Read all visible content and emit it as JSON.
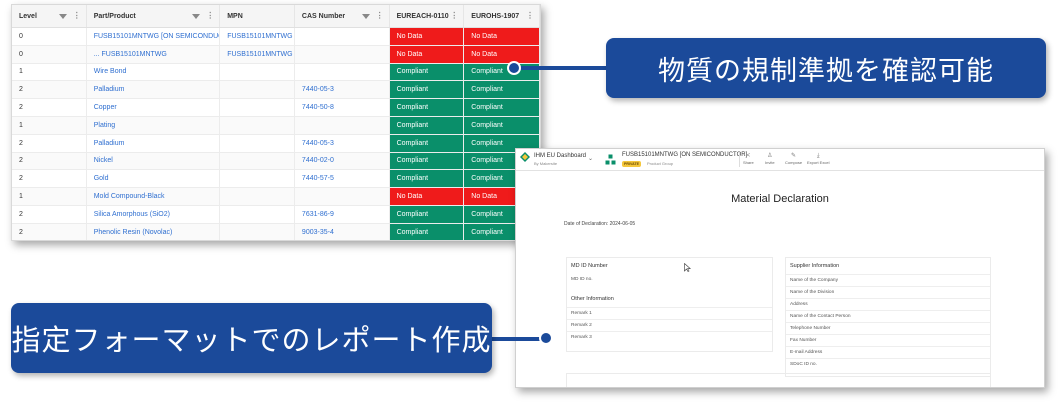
{
  "table": {
    "headers": [
      "Level",
      "Part/Product",
      "MPN",
      "CAS Number",
      "EUREACH-0110",
      "EUROHS-1907"
    ],
    "rows": [
      {
        "level": "0",
        "part": "FUSB15101MNTWG [ON SEMICONDUCTOR]",
        "mpn": "FUSB15101MNTWG",
        "cas": "",
        "reach": "No Data",
        "rohs": "No Data"
      },
      {
        "level": "0",
        "part": "... FUSB15101MNTWG",
        "mpn": "FUSB15101MNTWG",
        "cas": "",
        "reach": "No Data",
        "rohs": "No Data"
      },
      {
        "level": "1",
        "part": "Wire Bond",
        "mpn": "",
        "cas": "",
        "reach": "Compliant",
        "rohs": "Compliant"
      },
      {
        "level": "2",
        "part": "Palladium",
        "mpn": "",
        "cas": "7440-05-3",
        "reach": "Compliant",
        "rohs": "Compliant"
      },
      {
        "level": "2",
        "part": "Copper",
        "mpn": "",
        "cas": "7440-50-8",
        "reach": "Compliant",
        "rohs": "Compliant"
      },
      {
        "level": "1",
        "part": "Plating",
        "mpn": "",
        "cas": "",
        "reach": "Compliant",
        "rohs": "Compliant"
      },
      {
        "level": "2",
        "part": "Palladium",
        "mpn": "",
        "cas": "7440-05-3",
        "reach": "Compliant",
        "rohs": "Compliant"
      },
      {
        "level": "2",
        "part": "Nickel",
        "mpn": "",
        "cas": "7440-02-0",
        "reach": "Compliant",
        "rohs": "Compliant"
      },
      {
        "level": "2",
        "part": "Gold",
        "mpn": "",
        "cas": "7440-57-5",
        "reach": "Compliant",
        "rohs": "Compliant"
      },
      {
        "level": "1",
        "part": "Mold Compound-Black",
        "mpn": "",
        "cas": "",
        "reach": "No Data",
        "rohs": "No Data"
      },
      {
        "level": "2",
        "part": "Silica Amorphous (SiO2)",
        "mpn": "",
        "cas": "7631-86-9",
        "reach": "Compliant",
        "rohs": "Compliant"
      },
      {
        "level": "2",
        "part": "Phenolic Resin (Novolac)",
        "mpn": "",
        "cas": "9003-35-4",
        "reach": "Compliant",
        "rohs": "Compliant"
      }
    ]
  },
  "callouts": {
    "top": "物質の規制準拠を確認可能",
    "bottom": "指定フォーマットでのレポート作成"
  },
  "app": {
    "dashboard_title": "IHM EU Dashboard",
    "dashboard_sub": "By Makersite",
    "product_title": "FUSB15101MNTWG [ON SEMICONDUCTOR]",
    "badge": "PRIVATE",
    "product_group": "Product Group",
    "toolbar": {
      "share": "Share",
      "invite": "Invite",
      "compose": "Compose",
      "export": "Export Excel"
    }
  },
  "doc": {
    "title": "Material Declaration",
    "date": "Date of Declaration: 2024-06-05",
    "md_head": "MD ID Number",
    "md_value": "MD ID no.",
    "other_head": "Other Information",
    "remarks": [
      "Remark 1",
      "Remark 2",
      "Remark 3"
    ],
    "supplier_head": "Supplier Information",
    "supplier_fields": [
      "Name of the Company",
      "Name of the Division",
      "Address",
      "Name of the Contact Person",
      "Telephone Number",
      "Fax Number",
      "E-mail Address",
      "SDoC ID no."
    ],
    "product_head": "Product Information"
  },
  "colors": {
    "no_data": "#ef1b1b",
    "compliant": "#0a8f6a",
    "callout": "#1b4a9a",
    "link": "#2f6fd0"
  }
}
